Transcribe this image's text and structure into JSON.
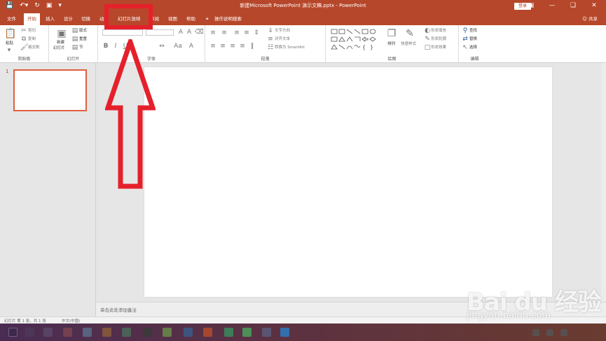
{
  "window": {
    "title": "新建Microsoft PowerPoint 演示文稿.pptx - PowerPoint",
    "login_label": "登录",
    "qat_icons": [
      "save-icon",
      "undo-icon",
      "redo-icon",
      "start-slideshow-icon",
      "customize-icon"
    ],
    "controls": [
      "ribbon-display-icon",
      "minimize-icon",
      "restore-icon",
      "close-icon"
    ]
  },
  "tabs": {
    "items": [
      {
        "label": "文件"
      },
      {
        "label": "开始"
      },
      {
        "label": "插入"
      },
      {
        "label": "设计"
      },
      {
        "label": "切换"
      },
      {
        "label": "动"
      },
      {
        "label": "幻灯片放映"
      },
      {
        "label": "审阅"
      },
      {
        "label": "视图"
      },
      {
        "label": "帮助"
      }
    ],
    "active": "开始",
    "search_label": "操作说明搜索",
    "share_label": "共享"
  },
  "ribbon": {
    "clipboard": {
      "paste": "粘贴",
      "cut": "剪切",
      "copy": "复制",
      "format_painter": "格式刷",
      "label": "剪贴板"
    },
    "slides": {
      "new_slide_1": "新建",
      "new_slide_2": "幻灯片",
      "layout": "版式",
      "reset": "重置",
      "section": "节",
      "label": "幻灯片"
    },
    "font": {
      "label": "字体"
    },
    "paragraph": {
      "text_direction": "文字方向",
      "align_text": "对齐文本",
      "convert_smartart": "转换为 SmartArt",
      "label": "段落"
    },
    "drawing": {
      "arrange": "排列",
      "quick_styles": "快速样式",
      "shape_fill": "形状填充",
      "shape_outline": "形状轮廓",
      "shape_effects": "形状效果",
      "label": "绘图"
    },
    "editing": {
      "find": "查找",
      "replace": "替换",
      "select": "选择",
      "label": "编辑"
    }
  },
  "thumbnails": {
    "slide_number": "1"
  },
  "notes": {
    "placeholder": "单击此处添加备注"
  },
  "statusbar": {
    "slide_info": "幻灯片 第 1 张，共 1 张",
    "language": "中文(中国)"
  },
  "watermark": {
    "brand": "Bai du 经验",
    "url": "jingyan.baidu.com"
  },
  "colors": {
    "accent": "#b7472a",
    "annotation_red": "#e5202b",
    "thumb_border": "#e0603f"
  }
}
